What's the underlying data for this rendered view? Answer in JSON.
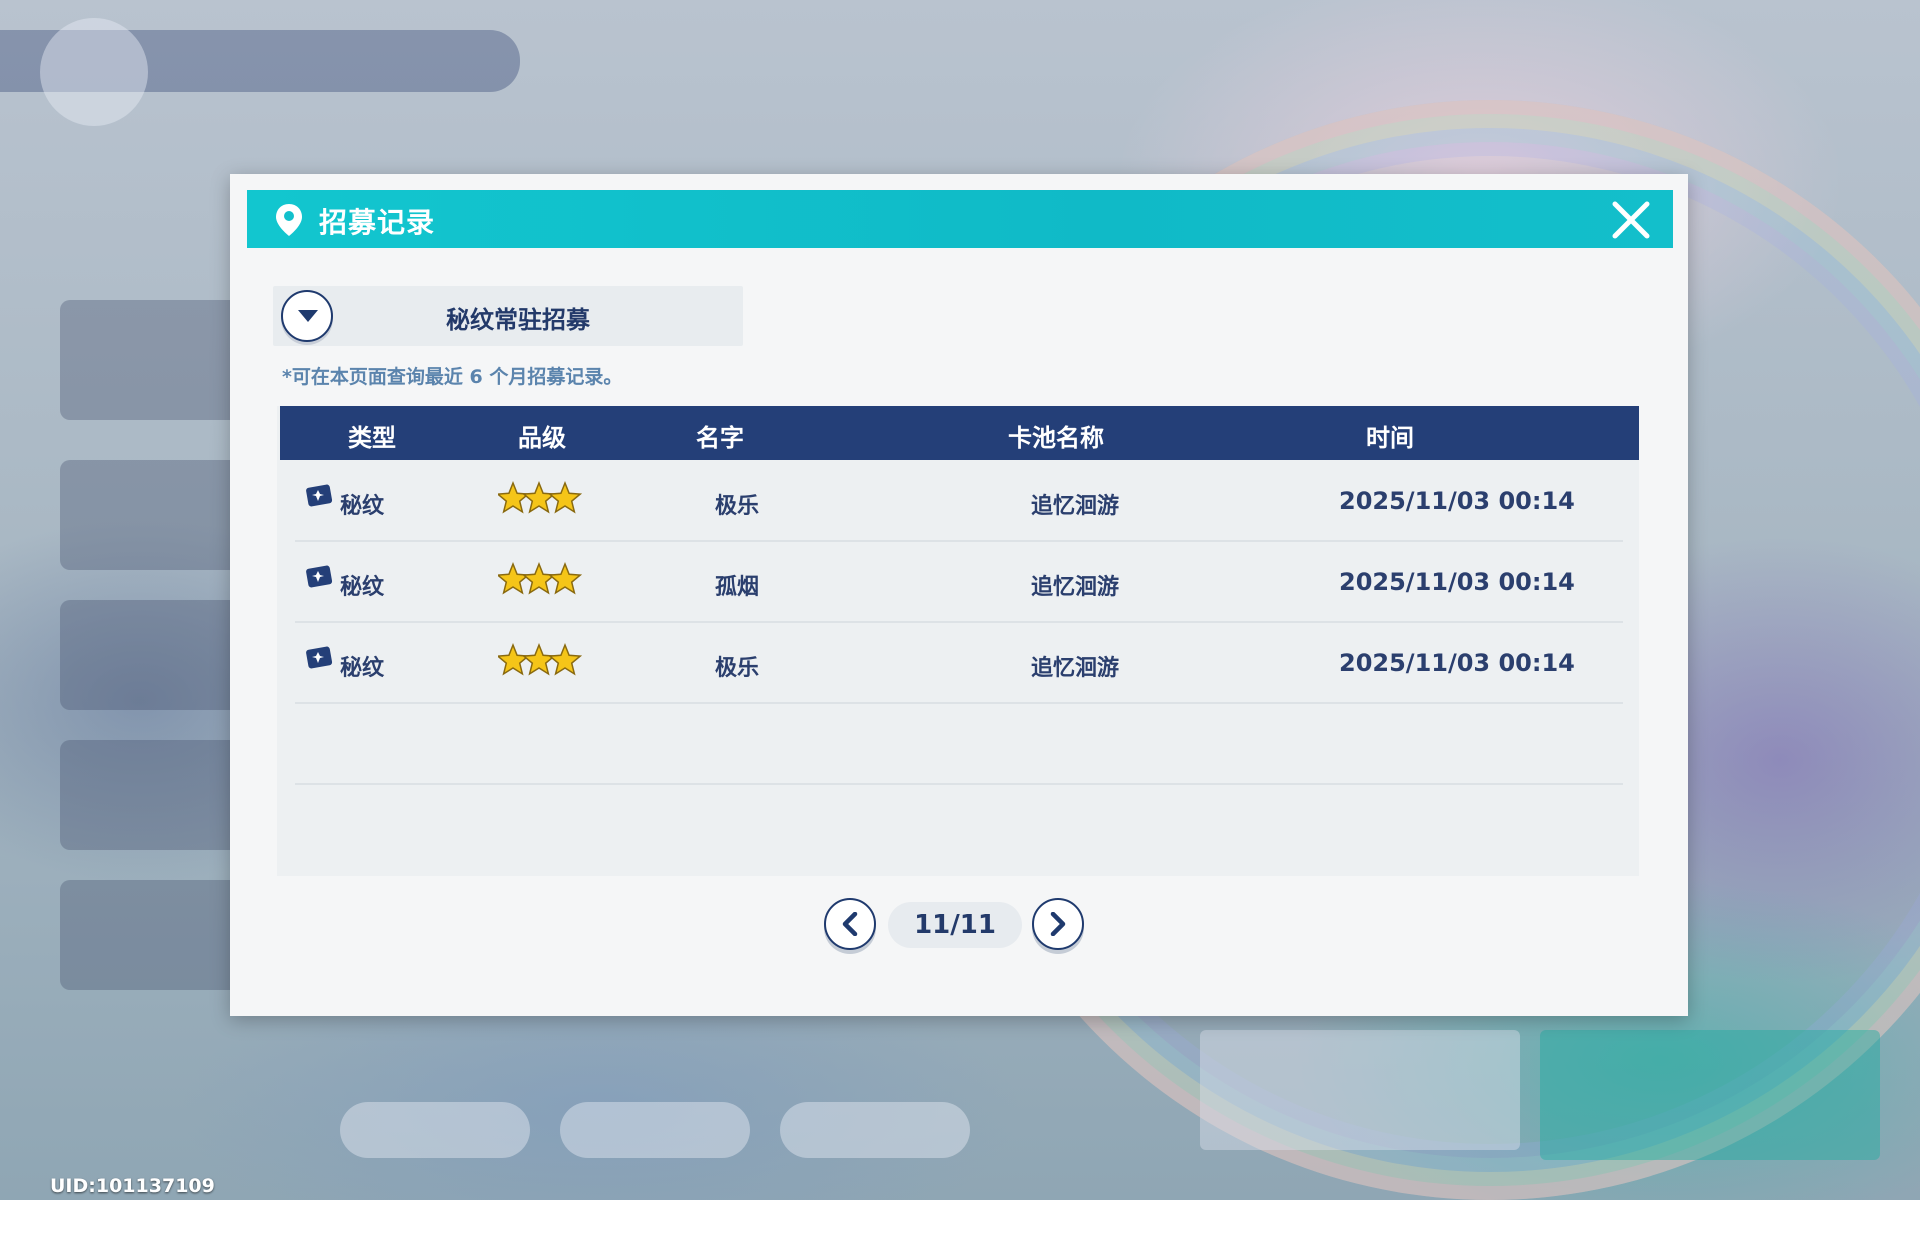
{
  "dialog": {
    "title": "招募记录"
  },
  "pool_selector": {
    "selected": "秘纹常驻招募"
  },
  "note": "*可在本页面查询最近 6 个月招募记录。",
  "table": {
    "headers": {
      "type": "类型",
      "rarity": "品级",
      "name": "名字",
      "pool": "卡池名称",
      "time": "时间"
    },
    "rows": [
      {
        "type": "秘纹",
        "stars": 3,
        "name": "极乐",
        "pool": "追忆洄游",
        "time": "2025/11/03 00:14"
      },
      {
        "type": "秘纹",
        "stars": 3,
        "name": "孤烟",
        "pool": "追忆洄游",
        "time": "2025/11/03 00:14"
      },
      {
        "type": "秘纹",
        "stars": 3,
        "name": "极乐",
        "pool": "追忆洄游",
        "time": "2025/11/03 00:14"
      }
    ]
  },
  "pagination": {
    "page_label": "11/11"
  },
  "footer": {
    "uid": "UID:101137109"
  },
  "colors": {
    "title_bar": "#12c6cf",
    "header_bg": "#243f78",
    "text_dark": "#2b3f6e",
    "note_text": "#5b84ad",
    "star": "#f5c518"
  },
  "icons": {
    "title": "location-pin-icon",
    "close": "close-icon",
    "dropdown": "chevron-down-icon",
    "type": "rune-card-icon",
    "prev": "chevron-left-icon",
    "next": "chevron-right-icon"
  }
}
